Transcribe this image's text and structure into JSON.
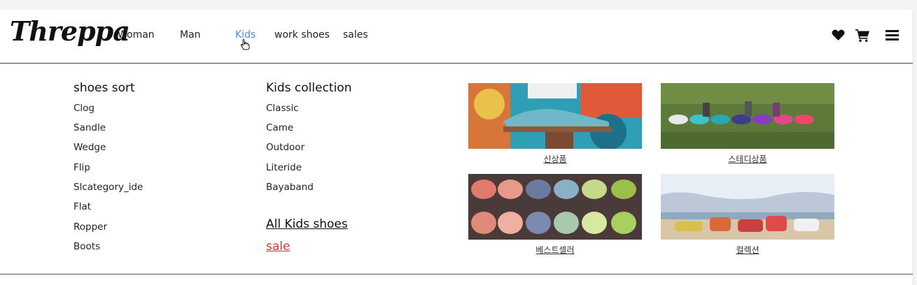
{
  "brand": {
    "logo": "Threppa"
  },
  "nav": {
    "items": [
      {
        "label": "Woman"
      },
      {
        "label": "Man"
      },
      {
        "label": "Kids"
      },
      {
        "label": "work shoes"
      },
      {
        "label": "sales"
      }
    ],
    "active": "Kids"
  },
  "header_icons": [
    "heart-icon",
    "cart-icon",
    "menu-icon"
  ],
  "menu": {
    "shoes_sort": {
      "title": "shoes sort",
      "items": [
        "Clog",
        "Sandle",
        "Wedge",
        "Flip",
        "Slcategory_ide",
        "Flat",
        "Ropper",
        "Boots"
      ]
    },
    "kids_collection": {
      "title": "Kids collection",
      "items": [
        "Classic",
        "Came",
        "Outdoor",
        "Literide",
        "Bayaband"
      ],
      "all_link": "All Kids shoes",
      "sale_link": "sale"
    },
    "promos": [
      {
        "caption": "신상품"
      },
      {
        "caption": "스테디상품"
      },
      {
        "caption": "베스트셀러"
      },
      {
        "caption": "컬렉션"
      }
    ]
  },
  "colors": {
    "active_nav": "#4a8fd6",
    "sale": "#c53d2f",
    "text": "#222222"
  }
}
